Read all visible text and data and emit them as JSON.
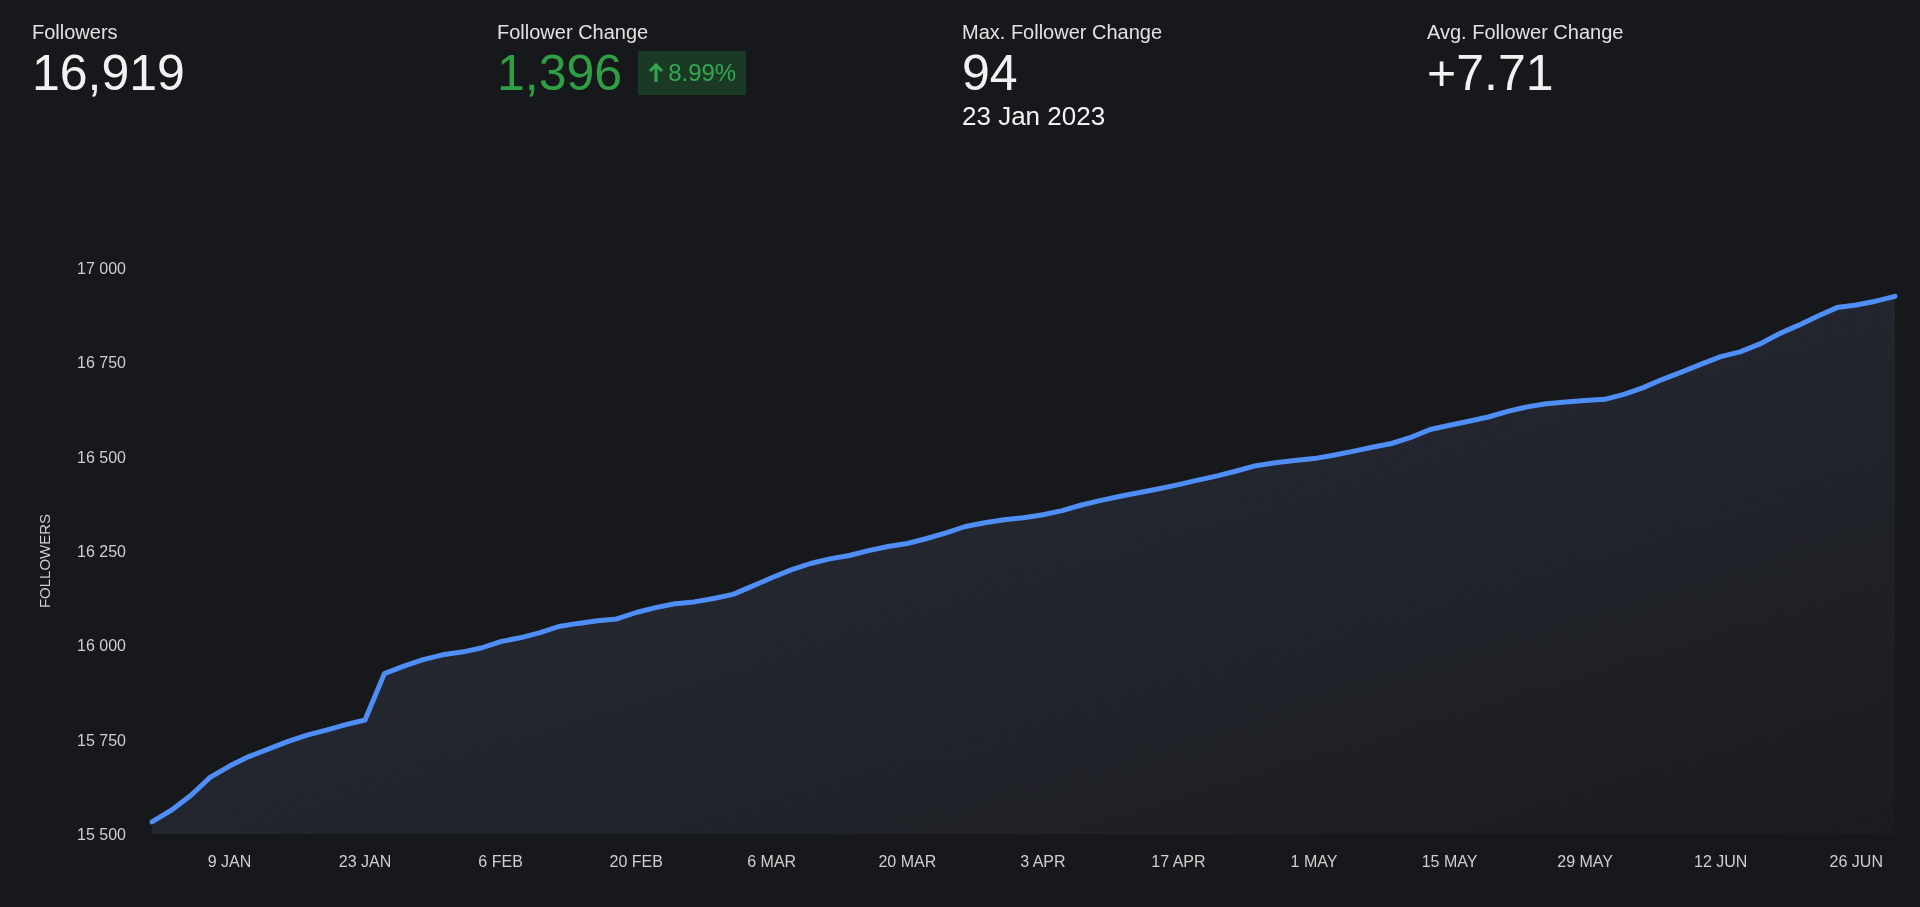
{
  "stats": [
    {
      "label": "Followers",
      "value": "16,919",
      "kind": "plain"
    },
    {
      "label": "Follower Change",
      "value": "1,396",
      "kind": "positive",
      "badge": {
        "text": "8.99%"
      }
    },
    {
      "label": "Max. Follower Change",
      "value": "94",
      "sub": "23 Jan 2023",
      "kind": "plain"
    },
    {
      "label": "Avg. Follower Change",
      "value": "+7.71",
      "kind": "plain"
    }
  ],
  "chart": {
    "chart_data": {
      "type": "area",
      "ylabel": "FOLLOWERS",
      "categories": [
        null,
        null,
        null,
        null,
        "9 JAN",
        null,
        null,
        null,
        null,
        null,
        null,
        "23 JAN",
        null,
        null,
        null,
        null,
        null,
        null,
        "6 FEB",
        null,
        null,
        null,
        null,
        null,
        null,
        "20 FEB",
        null,
        null,
        null,
        null,
        null,
        null,
        "6 MAR",
        null,
        null,
        null,
        null,
        null,
        null,
        "20 MAR",
        null,
        null,
        null,
        null,
        null,
        null,
        "3 APR",
        null,
        null,
        null,
        null,
        null,
        null,
        "17 APR",
        null,
        null,
        null,
        null,
        null,
        null,
        "1 MAY",
        null,
        null,
        null,
        null,
        null,
        null,
        "15 MAY",
        null,
        null,
        null,
        null,
        null,
        null,
        "29 MAY",
        null,
        null,
        null,
        null,
        null,
        null,
        "12 JUN",
        null,
        null,
        null,
        null,
        null,
        null,
        "26 JUN",
        null,
        null
      ],
      "series": [
        {
          "color": "#4f8ef7",
          "values": [
            15532,
            15563,
            15602,
            15650,
            15680,
            15705,
            15725,
            15745,
            15762,
            15775,
            15790,
            15802,
            15925,
            15945,
            15962,
            15975,
            15982,
            15993,
            16010,
            16020,
            16033,
            16050,
            16058,
            16065,
            16070,
            16087,
            16100,
            16110,
            16115,
            16124,
            16135,
            16157,
            16179,
            16200,
            16217,
            16229,
            16238,
            16251,
            16262,
            16270,
            16283,
            16298,
            16315,
            16325,
            16333,
            16338,
            16346,
            16357,
            16372,
            16384,
            16395,
            16405,
            16415,
            16426,
            16438,
            16449,
            16462,
            16476,
            16484,
            16490,
            16495,
            16504,
            16514,
            16525,
            16535,
            16551,
            16572,
            16583,
            16594,
            16605,
            16620,
            16632,
            16640,
            16645,
            16649,
            16652,
            16665,
            16683,
            16705,
            16725,
            16745,
            16765,
            16778,
            16798,
            16825,
            16848,
            16872,
            16895,
            16902,
            16912,
            16925
          ]
        }
      ],
      "ylim": [
        15500,
        17000
      ],
      "yticks": [
        {
          "value": 15500,
          "label": "15 500"
        },
        {
          "value": 15750,
          "label": "15 750"
        },
        {
          "value": 16000,
          "label": "16 000"
        },
        {
          "value": 16250,
          "label": "16 250"
        },
        {
          "value": 16500,
          "label": "16 500"
        },
        {
          "value": 16750,
          "label": "16 750"
        },
        {
          "value": 17000,
          "label": "17 000"
        }
      ]
    }
  }
}
